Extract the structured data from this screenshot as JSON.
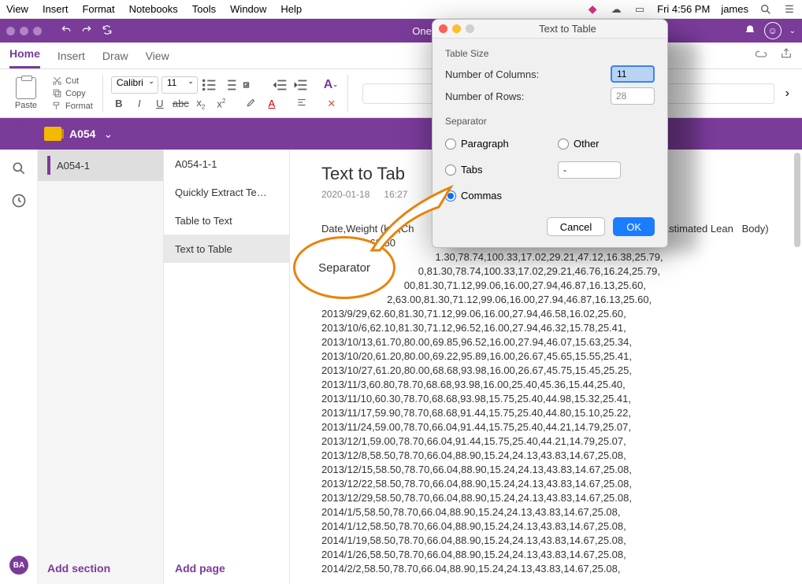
{
  "menubar": {
    "items": [
      "View",
      "Insert",
      "Format",
      "Notebooks",
      "Tools",
      "Window",
      "Help"
    ],
    "clock": "Fri 4:56 PM",
    "user": "james"
  },
  "titlebar": {
    "title": "OneNote"
  },
  "ribbon": {
    "tabs": [
      "Home",
      "Insert",
      "Draw",
      "View"
    ],
    "paste": "Paste",
    "cut": "Cut",
    "copy": "Copy",
    "format": "Format",
    "font_name": "Calibri",
    "font_size": "11"
  },
  "notebook": {
    "name": "A054"
  },
  "sections": {
    "items": [
      "A054-1"
    ],
    "add": "Add section"
  },
  "pages": {
    "items": [
      "A054-1-1",
      "Quickly Extract Te…",
      "Table to Text",
      "Text to Table"
    ],
    "add": "Add page"
  },
  "content": {
    "title": "Text to Tab",
    "date": "2020-01-18",
    "time": "16:27",
    "header_line": "Date,Weight (kg),Ch                                                                                  m),Estimated Lean   Body)",
    "lines": [
      "                                        1.30,78.74,100.33,17.02,29.21,47.12,16.38,25.79,",
      "                                  0,81.30,78.74,100.33,17.02,29.21,46.76,16.24,25.79,",
      "                             00,81.30,71.12,99.06,16.00,27.94,46.87,16.13,25.60,",
      "                       2,63.00,81.30,71.12,99.06,16.00,27.94,46.87,16.13,25.60,",
      "2013/9/29,62.60,81.30,71.12,99.06,16.00,27.94,46.58,16.02,25.60,",
      "2013/10/6,62.10,81.30,71.12,96.52,16.00,27.94,46.32,15.78,25.41,",
      "2013/10/13,61.70,80.00,69.85,96.52,16.00,27.94,46.07,15.63,25.34,",
      "2013/10/20,61.20,80.00,69.22,95.89,16.00,26.67,45.65,15.55,25.41,",
      "2013/10/27,61.20,80.00,68.68,93.98,16.00,26.67,45.75,15.45,25.25,",
      "2013/11/3,60.80,78.70,68.68,93.98,16.00,25.40,45.36,15.44,25.40,",
      "2013/11/10,60.30,78.70,68.68,93.98,15.75,25.40,44.98,15.32,25.41,",
      "2013/11/17,59.90,78.70,68.68,91.44,15.75,25.40,44.80,15.10,25.22,",
      "2013/11/24,59.00,78.70,66.04,91.44,15.75,25.40,44.21,14.79,25.07,",
      "2013/12/1,59.00,78.70,66.04,91.44,15.75,25.40,44.21,14.79,25.07,",
      "2013/12/8,58.50,78.70,66.04,88.90,15.24,24.13,43.83,14.67,25.08,",
      "2013/12/15,58.50,78.70,66.04,88.90,15.24,24.13,43.83,14.67,25.08,",
      "2013/12/22,58.50,78.70,66.04,88.90,15.24,24.13,43.83,14.67,25.08,",
      "2013/12/29,58.50,78.70,66.04,88.90,15.24,24.13,43.83,14.67,25.08,",
      "2014/1/5,58.50,78.70,66.04,88.90,15.24,24.13,43.83,14.67,25.08,",
      "2014/1/12,58.50,78.70,66.04,88.90,15.24,24.13,43.83,14.67,25.08,",
      "2014/1/19,58.50,78.70,66.04,88.90,15.24,24.13,43.83,14.67,25.08,",
      "2014/1/26,58.50,78.70,66.04,88.90,15.24,24.13,43.83,14.67,25.08,",
      "2014/2/2,58.50,78.70,66.04,88.90,15.24,24.13,43.83,14.67,25.08,"
    ]
  },
  "dialog": {
    "title": "Text to Table",
    "table_size_label": "Table Size",
    "cols_label": "Number of Columns:",
    "cols_value": "11",
    "rows_label": "Number of Rows:",
    "rows_value": "28",
    "separator_label": "Separator",
    "opt_paragraph": "Paragraph",
    "opt_other": "Other",
    "opt_tabs": "Tabs",
    "opt_commas": "Commas",
    "other_value": "-",
    "cancel": "Cancel",
    "ok": "OK"
  },
  "callout": {
    "label": "Separator"
  },
  "avatar": "BA"
}
